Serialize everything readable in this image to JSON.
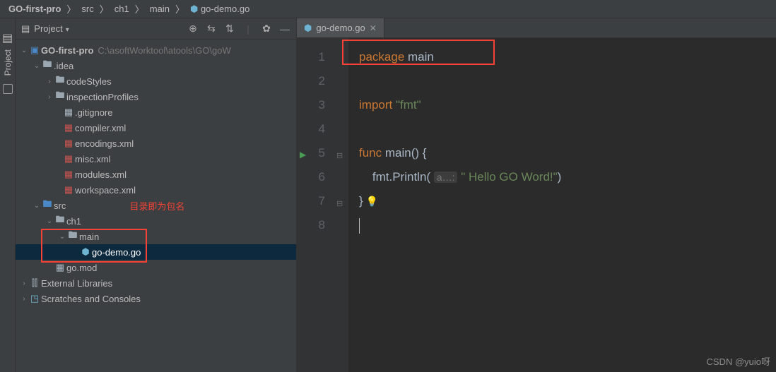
{
  "breadcrumbs": {
    "root": "GO-first-pro",
    "p1": "src",
    "p2": "ch1",
    "p3": "main",
    "p4": "go-demo.go"
  },
  "sidebar": {
    "title": "Project",
    "tree": {
      "root": "GO-first-pro",
      "root_path": "C:\\asoftWorktool\\atools\\GO\\goW",
      "idea": ".idea",
      "codeStyles": "codeStyles",
      "inspectionProfiles": "inspectionProfiles",
      "gitignore": ".gitignore",
      "compiler": "compiler.xml",
      "encodings": "encodings.xml",
      "misc": "misc.xml",
      "modules": "modules.xml",
      "workspace": "workspace.xml",
      "src": "src",
      "ch1": "ch1",
      "main": "main",
      "godemo": "go-demo.go",
      "gomod": "go.mod",
      "ext": "External Libraries",
      "scratch": "Scratches and Consoles"
    },
    "annotation": "目录即为包名"
  },
  "editor": {
    "tab": "go-demo.go",
    "lines": [
      "1",
      "2",
      "3",
      "4",
      "5",
      "6",
      "7",
      "8"
    ],
    "code": {
      "l1a": "package ",
      "l1b": "main",
      "l3a": "import ",
      "l3b": "\"fmt\"",
      "l5a": "func ",
      "l5b": "main",
      "l5c": "() {",
      "l6a": "    fmt.Println( ",
      "l6hint": "a…:",
      "l6b": " \" Hello GO Word!\"",
      "l6c": ")",
      "l7": "}"
    }
  },
  "watermark": "CSDN @yuio呀"
}
